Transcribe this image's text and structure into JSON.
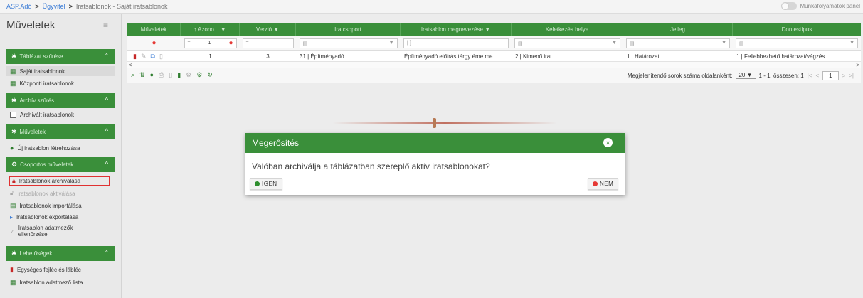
{
  "breadcrumb": {
    "c1": "ASP.Adó",
    "c2": "Ügyvitel",
    "c3": "Iratsablonok",
    "c4": "Saját iratsablonok"
  },
  "workflow_panel": "Munkafolyamatok panel",
  "sidebar": {
    "title": "Műveletek",
    "sec_filter": "Táblázat szűrése",
    "own_templates": "Saját iratsablonok",
    "central_templates": "Központi iratsablonok",
    "sec_archive": "Archív szűrés",
    "archived_templates": "Archivált iratsablonok",
    "sec_actions": "Műveletek",
    "new_template": "Új iratsablon létrehozása",
    "sec_group": "Csoportos műveletek",
    "archive_templates": "Iratsablonok archiválása",
    "activate_templates": "Iratsablonok aktiválása",
    "import_templates": "Iratsablonok importálása",
    "export_templates": "Iratsablonok exportálása",
    "check_line1": "Iratsablon adatmezők",
    "check_line2": "ellenőrzése",
    "sec_options": "Lehetőségek",
    "header_footer": "Egységes fejléc és lábléc",
    "field_list": "Iratsablon adatmező lista"
  },
  "table": {
    "columns": [
      "Műveletek",
      "↑ Azono... ▼",
      "Verzió ▼",
      "Iratcsoport",
      "Iratsablon megnevezése ▼",
      "Keletkezés helye",
      "Jelleg",
      "Dontestípus"
    ],
    "filter_id": "1",
    "row": {
      "id": "1",
      "version": "3",
      "group": "31 | Építményadó",
      "name": "Építményadó előírás tárgy éme me...",
      "origin": "2 | Kimenő irat",
      "type": "1 | Határozat",
      "decision": "1 | Fellebbezhető határozat/végzés"
    },
    "pager": {
      "rows_label": "Megjelenítendő sorok száma oldalanként:",
      "rows_value": "20",
      "summary": "1 - 1, összesen: 1",
      "page": "1"
    }
  },
  "dialog": {
    "title": "Megerősítés",
    "message": "Valóban archiválja a táblázatban szereplő aktív iratsablonokat?",
    "yes": "IGEN",
    "no": "NEM"
  },
  "colors": {
    "green": "#3a8f3a",
    "red": "#e53935"
  }
}
